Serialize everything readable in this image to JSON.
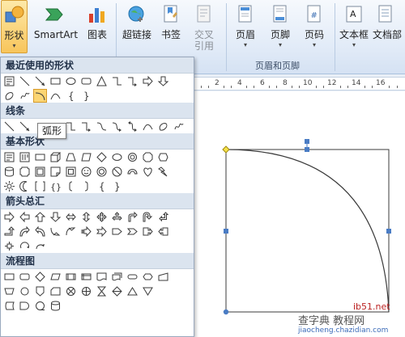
{
  "ribbon": {
    "buttons": {
      "shapes": "形状",
      "smartart": "SmartArt",
      "chart": "图表",
      "hyperlink": "超链接",
      "bookmark": "书签",
      "crossref_line1": "交叉",
      "crossref_line2": "引用",
      "header": "页眉",
      "footer": "页脚",
      "pagenum": "页码",
      "textbox": "文本框",
      "docparts": "文档部"
    },
    "group_header_footer": "页眉和页脚"
  },
  "ruler": {
    "numbers": [
      "2",
      "4",
      "6",
      "8",
      "10",
      "12",
      "14",
      "16"
    ]
  },
  "dropdown": {
    "sections": {
      "recent": "最近使用的形状",
      "lines": "线条",
      "basic": "基本形状",
      "arrows": "箭头总汇",
      "flowchart": "流程图"
    },
    "tooltip": "弧形"
  },
  "watermark": {
    "line1": "查字典 教程网",
    "site_short": "ib51.net",
    "url": "jiaocheng.chazidian.com"
  },
  "colors": {
    "accent_orange": "#f8c55b",
    "ribbon_blue": "#d5e2f3",
    "section_header": "#dbe4ef",
    "shape_stroke": "#3b3b3b",
    "handle_blue": "#4a7cc4",
    "handle_yellow": "#f6e24a"
  }
}
